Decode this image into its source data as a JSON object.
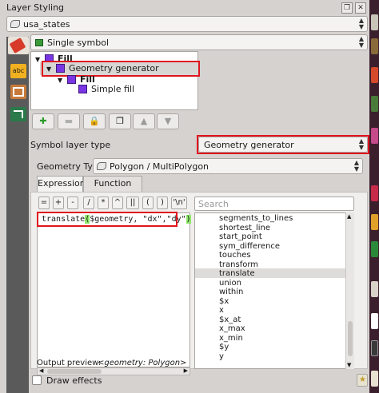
{
  "window": {
    "title": "Layer Styling",
    "float_glyph": "❐",
    "close_glyph": "✕"
  },
  "layer_combo": {
    "value": "usa_states",
    "icon": "polygon-layer-icon"
  },
  "renderer_combo": {
    "value": "Single symbol",
    "icon": "single-symbol-icon"
  },
  "symbol_tree": {
    "items": [
      {
        "label": "Fill",
        "level": 0,
        "expanded": true
      },
      {
        "label": "Geometry generator",
        "level": 1,
        "expanded": true,
        "selected": true
      },
      {
        "label": "Fill",
        "level": 2,
        "expanded": true
      },
      {
        "label": "Simple fill",
        "level": 3
      }
    ],
    "swatch_color": "#7a36e3"
  },
  "tree_toolbar": {
    "add": "✚",
    "remove": "▬",
    "lock": "🔒",
    "duplicate": "❐",
    "up": "▲",
    "down": "▼"
  },
  "symbol_layer_type": {
    "label": "Symbol layer type",
    "value": "Geometry generator"
  },
  "geometry_type": {
    "label": "Geometry Type",
    "value": "Polygon / MultiPolygon"
  },
  "tabs": [
    {
      "label": "Expression",
      "active": true
    },
    {
      "label": "Function Editor",
      "active": false
    }
  ],
  "operators": [
    "=",
    "+",
    "-",
    "/",
    "*",
    "^",
    "||",
    "(",
    ")",
    "'\\n'"
  ],
  "expression": {
    "fn": "translate",
    "open": "(",
    "args": "$geometry, \"dx\",\"dy\"",
    "close": ")"
  },
  "search": {
    "placeholder": "Search"
  },
  "function_list": [
    "segments_to_lines",
    "shortest_line",
    "start_point",
    "sym_difference",
    "touches",
    "transform",
    "translate",
    "union",
    "within",
    "$x",
    "x",
    "$x_at",
    "x_max",
    "x_min",
    "$y",
    "y"
  ],
  "selected_function": "translate",
  "output_preview": {
    "label": "Output preview:",
    "value": "<geometry: Polygon>"
  },
  "draw_effects": {
    "label": "Draw effects",
    "checked": false
  },
  "accent": "#e0141e",
  "highlight": "#c9dcf2",
  "arg_highlight": "#8ee86a"
}
